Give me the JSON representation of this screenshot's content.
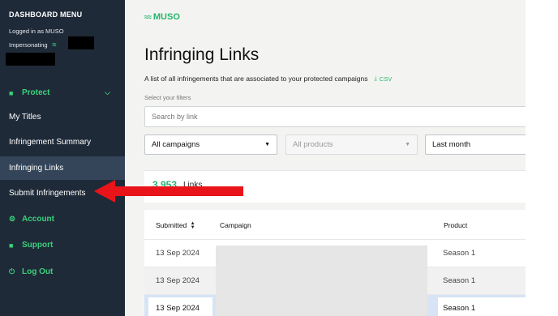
{
  "sidebar": {
    "title": "DASHBOARD MENU",
    "logged_in": "Logged in as MUSO",
    "impersonating": "Impersonating",
    "items": [
      {
        "label": "Protect",
        "icon": "shield-icon"
      },
      {
        "label": "My Titles"
      },
      {
        "label": "Infringement Summary"
      },
      {
        "label": "Infringing Links"
      },
      {
        "label": "Submit Infringements"
      },
      {
        "label": "Account",
        "icon": "gear-icon"
      },
      {
        "label": "Support",
        "icon": "chat-icon"
      },
      {
        "label": "Log Out",
        "icon": "power-icon"
      }
    ]
  },
  "main": {
    "logo": "MUSO",
    "title": "Infringing Links",
    "subtitle": "A list of all infringements that are associated to your protected campaigns",
    "csv_label": "CSV",
    "filter_label": "Select your filters",
    "search_placeholder": "Search by link",
    "filters": {
      "campaign": "All campaigns",
      "product": "All products",
      "period": "Last month"
    },
    "count_value": "3,953",
    "count_label": "Links",
    "table": {
      "headers": [
        "Submitted",
        "Campaign",
        "Product"
      ],
      "rows": [
        {
          "submitted": "13 Sep 2024",
          "product": "Season 1"
        },
        {
          "submitted": "13 Sep 2024",
          "product": "Season 1"
        },
        {
          "submitted": "13 Sep 2024",
          "product": "Season 1"
        }
      ]
    }
  },
  "colors": {
    "sidebar_bg": "#1f2a38",
    "accent": "#27b46d",
    "annotation_arrow": "#e8141a"
  }
}
